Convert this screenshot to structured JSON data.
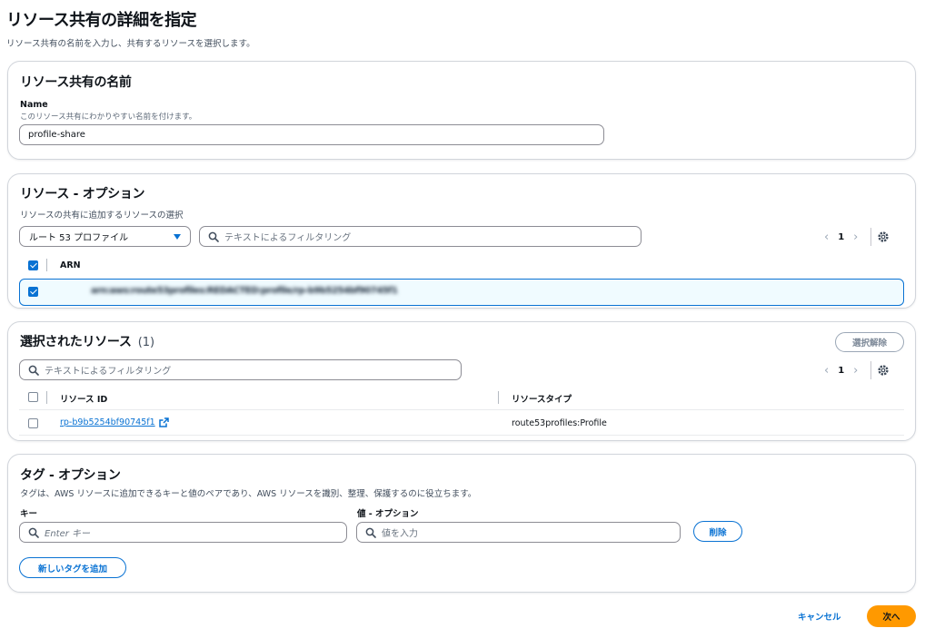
{
  "page": {
    "title": "リソース共有の詳細を指定",
    "description": "リソース共有の名前を入力し、共有するリソースを選択します。"
  },
  "name_section": {
    "title": "リソース共有の名前",
    "field_label": "Name",
    "field_hint": "このリソース共有にわかりやすい名前を付けます。",
    "value": "profile-share"
  },
  "resources_section": {
    "title": "リソース - オプション",
    "description": "リソースの共有に追加するリソースの選択",
    "resource_type": "ルート 53 プロファイル",
    "filter_placeholder": "テキストによるフィルタリング",
    "page": "1",
    "column_arn": "ARN",
    "rows": [
      {
        "arn": "arn:aws:route53profiles:REDACTED:profile/rp-b9b5254bf90745f1",
        "selected": true
      }
    ]
  },
  "selected_section": {
    "title": "選択されたリソース",
    "count": "(1)",
    "deselect_label": "選択解除",
    "filter_placeholder": "テキストによるフィルタリング",
    "page": "1",
    "column_id": "リソース ID",
    "column_type": "リソースタイプ",
    "rows": [
      {
        "id": "rp-b9b5254bf90745f1",
        "type": "route53profiles:Profile"
      }
    ]
  },
  "tags_section": {
    "title": "タグ - オプション",
    "description": "タグは、AWS リソースに追加できるキーと値のペアであり、AWS リソースを識別、整理、保護するのに役立ちます。",
    "key_label": "キー",
    "value_label": "値 - オプション",
    "key_placeholder": "Enter キー",
    "value_placeholder": "値を入力",
    "remove_label": "削除",
    "add_label": "新しいタグを追加"
  },
  "footer": {
    "cancel_label": "キャンセル",
    "next_label": "次へ"
  },
  "colors": {
    "accent": "#0972d3",
    "primary_button": "#ff9900",
    "selected_row_bg": "#f0fbff"
  }
}
